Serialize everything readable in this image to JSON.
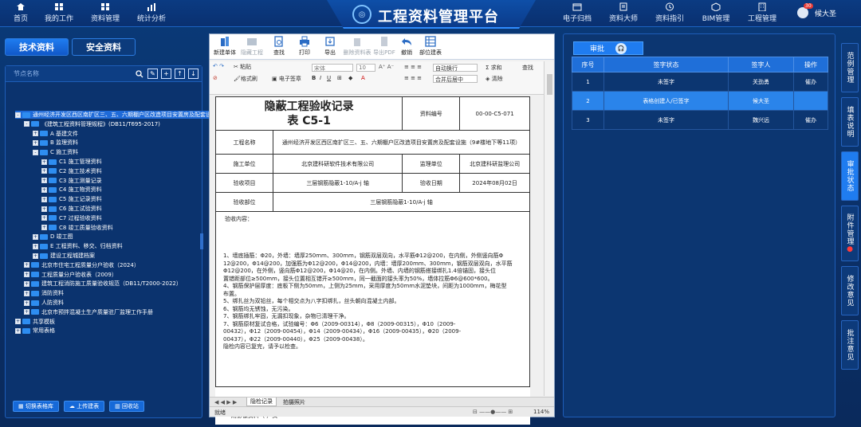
{
  "topnav": {
    "left": [
      {
        "label": "首页",
        "icon": "home-icon"
      },
      {
        "label": "我的工作",
        "icon": "grid-icon"
      },
      {
        "label": "资料管理",
        "icon": "grid-icon"
      },
      {
        "label": "统计分析",
        "icon": "bar-chart-icon"
      }
    ],
    "right": [
      {
        "label": "电子归档",
        "icon": "archive-icon"
      },
      {
        "label": "资料大师",
        "icon": "book-icon"
      },
      {
        "label": "资料指引",
        "icon": "guide-icon"
      },
      {
        "label": "BIM管理",
        "icon": "cube-icon"
      },
      {
        "label": "工程管理",
        "icon": "building-icon"
      }
    ],
    "title": "工程资料管理平台",
    "user": {
      "name": "候大圣",
      "badge": "30"
    }
  },
  "left": {
    "tabs": [
      "技术资料",
      "安全资料"
    ],
    "search_placeholder": "节点名称",
    "tree": [
      {
        "label": "通州经济开发区西区南扩区三、五、六期棚户区改造项目安置房及配套设",
        "level": 0,
        "pm": "-"
      },
      {
        "label": "《建筑工程资料管理规程》(DB11/T695-2017)",
        "level": 1,
        "pm": "-"
      },
      {
        "label": "A 基建文件",
        "level": 2,
        "pm": "+"
      },
      {
        "label": "B 监理资料",
        "level": 2,
        "pm": "+"
      },
      {
        "label": "C 施工资料",
        "level": 2,
        "pm": "-"
      },
      {
        "label": "C1 施工管理资料",
        "level": 3,
        "pm": "+"
      },
      {
        "label": "C2 施工技术资料",
        "level": 3,
        "pm": "+"
      },
      {
        "label": "C3 施工测量记录",
        "level": 3,
        "pm": "+"
      },
      {
        "label": "C4 施工物资资料",
        "level": 3,
        "pm": "+"
      },
      {
        "label": "C5 施工记录资料",
        "level": 3,
        "pm": "+"
      },
      {
        "label": "C6 施工试验资料",
        "level": 3,
        "pm": "+"
      },
      {
        "label": "C7 过程验收资料",
        "level": 3,
        "pm": "+"
      },
      {
        "label": "C8 竣工质量验收资料",
        "level": 3,
        "pm": "+"
      },
      {
        "label": "D 竣工图",
        "level": 2,
        "pm": "+"
      },
      {
        "label": "E 工程资料、移交、归档资料",
        "level": 2,
        "pm": "+"
      },
      {
        "label": "建设工程城建档案",
        "level": 2,
        "pm": "+"
      },
      {
        "label": "北京市住宅工程质量分户验收（2024）",
        "level": 1,
        "pm": "+"
      },
      {
        "label": "工程质量分户验收表（2009）",
        "level": 1,
        "pm": "+"
      },
      {
        "label": "建筑工程消防施工质量验收规范（DB11/T2000-2022）",
        "level": 1,
        "pm": "+"
      },
      {
        "label": "消防资料",
        "level": 1,
        "pm": "+"
      },
      {
        "label": "人防资料",
        "level": 1,
        "pm": "+"
      },
      {
        "label": "北京市预拌混凝土生产质量驻厂监理工作手册",
        "level": 1,
        "pm": "+"
      },
      {
        "label": "共享模板",
        "level": 0,
        "pm": "+"
      },
      {
        "label": "常用表格",
        "level": 0,
        "pm": "+"
      }
    ],
    "buttons": [
      "切换表格库",
      "上传建表",
      "回收站"
    ]
  },
  "doc": {
    "ribbon": [
      "新建单体",
      "隐藏工程",
      "查找",
      "打印",
      "导出",
      "删除资料表",
      "导出PDF",
      "撤销",
      "部位建表"
    ],
    "format": {
      "undo_items": [
        "粘贴",
        "格式刷",
        "电子签章"
      ],
      "font": "宋体",
      "size": "10",
      "wrap": "自动换行",
      "merge": "合并后居中",
      "sum": "求和",
      "clear": "清除",
      "find": "查找"
    },
    "form": {
      "title_line1": "隐蔽工程验收记录",
      "title_line2": "表 C5-1",
      "doc_no_label": "资料编号",
      "doc_no": "00-00-C5-071",
      "project_label": "工程名称",
      "project": "通州经济开发区西区南扩区三、五、六期棚户区改造项目安置房及配套设施（9#楼地下等11项）",
      "builder_label": "施工单位",
      "builder": "北京建科研软件技术有限公司",
      "supervisor_label": "监理单位",
      "supervisor": "北京建科研监理公司",
      "item_label": "验收项目",
      "item": "三层钢筋隐蔽1-10/A-j 轴",
      "date_label": "验收日期",
      "date": "2024年08月02日",
      "part_label": "验收部位",
      "part": "三层钢筋隐蔽1-10/A-j 轴",
      "content_label": "验收内容：",
      "content": [
        "1、墙底插筋：Φ20，外墙：墙厚250mm、300mm，钢筋双层双向，水平筋Φ12@200，在内侧，外侧竖向筋Φ",
        "12@200，Φ14@200，加强筋为Φ12@200，Φ14@200，内墙：墙厚200mm、300mm，钢筋双层双向，水平筋",
        "Φ12@200，在外侧，竖向筋Φ12@200，Φ14@20，在内侧。外墙、内墙的钢筋搭接绑扎1.4倍锚固，接头位",
        "置错距部位≥500mm，接头位置相互错开≥500mm，同一截面的接头率为50%，墙体拉筋Φ6@600*600。",
        "4、钢筋保护层厚度：底板下侧为50mm，上侧为25mm，采用厚度为50mm水泥垫块，间距为1000mm，梅花型",
        "布置。",
        "5、绑扎丝为双铅丝，每个相交点为八字扣绑扎，丝头朝向混凝土内部。",
        "6、钢筋均无锈蚀，无污染。",
        "7、钢筋绑扎牢固，无漏扣现象，杂物已清理干净。",
        "7、钢筋原材复试合格，试验编号：Φ6（2009-00314），Φ8（2009-00315），Φ10（2009-",
        "00432），Φ12（2009-00454），Φ14（2009-00434），Φ16（2009-00435），Φ20（2009-",
        "00437），Φ22（2009-00440），Φ25（2009-00438）。",
        "隐检内容已复完，请予以检查。"
      ],
      "attach": "附影像资料（        ）页"
    },
    "sheet_tabs": [
      "隐检记录",
      "拍摄照片"
    ],
    "status_left": "就绪",
    "zoom": "114%"
  },
  "right": {
    "tab": "审批",
    "columns": [
      "序号",
      "签字状态",
      "签字人",
      "操作"
    ],
    "rows": [
      {
        "no": "1",
        "status": "未签字",
        "signer": "关劲勇",
        "action": "催办"
      },
      {
        "no": "2",
        "status": "表格创建人/已签字",
        "signer": "候大圣",
        "action": ""
      },
      {
        "no": "3",
        "status": "未签字",
        "signer": "魏兴远",
        "action": "催办"
      }
    ],
    "vtabs": [
      "范例管理",
      "填表说明",
      "审批状态",
      "附件管理",
      "修改意见",
      "批注意见"
    ]
  },
  "colors": {
    "accent": "#1f7cf0",
    "action": "#ffd54a",
    "alert": "#e53935"
  }
}
